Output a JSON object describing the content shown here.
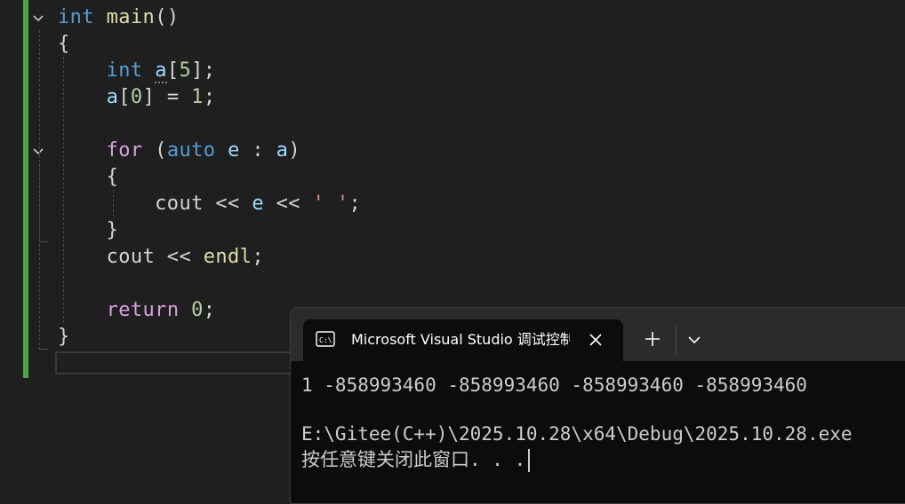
{
  "editor": {
    "lines": [
      {
        "tokens": [
          {
            "t": "int",
            "c": "k"
          },
          {
            "t": " ",
            "c": "p"
          },
          {
            "t": "main",
            "c": "f"
          },
          {
            "t": "()",
            "c": "p"
          }
        ]
      },
      {
        "tokens": [
          {
            "t": "{",
            "c": "p"
          }
        ]
      },
      {
        "tokens": [
          {
            "t": "    ",
            "c": "p"
          },
          {
            "t": "int",
            "c": "k"
          },
          {
            "t": " ",
            "c": "p"
          },
          {
            "t": "a",
            "c": "v squig"
          },
          {
            "t": "[",
            "c": "p"
          },
          {
            "t": "5",
            "c": "n"
          },
          {
            "t": "];",
            "c": "p"
          }
        ]
      },
      {
        "tokens": [
          {
            "t": "    ",
            "c": "p"
          },
          {
            "t": "a",
            "c": "v"
          },
          {
            "t": "[",
            "c": "p"
          },
          {
            "t": "0",
            "c": "n"
          },
          {
            "t": "] = ",
            "c": "p"
          },
          {
            "t": "1",
            "c": "n"
          },
          {
            "t": ";",
            "c": "p"
          }
        ]
      },
      {
        "tokens": []
      },
      {
        "tokens": [
          {
            "t": "    ",
            "c": "p"
          },
          {
            "t": "for",
            "c": "c"
          },
          {
            "t": " (",
            "c": "p"
          },
          {
            "t": "auto",
            "c": "k"
          },
          {
            "t": " ",
            "c": "p"
          },
          {
            "t": "e",
            "c": "v"
          },
          {
            "t": " : ",
            "c": "p"
          },
          {
            "t": "a",
            "c": "v"
          },
          {
            "t": ")",
            "c": "p"
          }
        ]
      },
      {
        "tokens": [
          {
            "t": "    {",
            "c": "p"
          }
        ]
      },
      {
        "tokens": [
          {
            "t": "        cout << ",
            "c": "p"
          },
          {
            "t": "e",
            "c": "v"
          },
          {
            "t": " << ",
            "c": "p"
          },
          {
            "t": "' '",
            "c": "s"
          },
          {
            "t": ";",
            "c": "p"
          }
        ]
      },
      {
        "tokens": [
          {
            "t": "    }",
            "c": "p"
          }
        ]
      },
      {
        "tokens": [
          {
            "t": "    cout << ",
            "c": "p"
          },
          {
            "t": "endl",
            "c": "f"
          },
          {
            "t": ";",
            "c": "p"
          }
        ]
      },
      {
        "tokens": []
      },
      {
        "tokens": [
          {
            "t": "    ",
            "c": "p"
          },
          {
            "t": "return",
            "c": "c"
          },
          {
            "t": " ",
            "c": "p"
          },
          {
            "t": "0",
            "c": "n"
          },
          {
            "t": ";",
            "c": "p"
          }
        ]
      },
      {
        "tokens": [
          {
            "t": "}",
            "c": "p"
          }
        ]
      }
    ]
  },
  "console": {
    "tab_title": "Microsoft Visual Studio 调试控制台",
    "output": [
      "1 -858993460 -858993460 -858993460 -858993460",
      "",
      "E:\\Gitee(C++)\\2025.10.28\\x64\\Debug\\2025.10.28.exe",
      "按任意键关闭此窗口. . ."
    ]
  },
  "icons": {
    "fold": "chevron-down-icon",
    "tab": "console-app-icon",
    "close": "close-icon",
    "new_tab": "plus-icon",
    "dropdown": "chevron-down-icon"
  },
  "colors": {
    "change_bar": "#4fa34a",
    "keyword": "#569cd6",
    "control": "#d8a0df",
    "function": "#dcdcaa",
    "variable": "#9cdcfe",
    "number": "#b5cea8",
    "string": "#d69d85"
  }
}
